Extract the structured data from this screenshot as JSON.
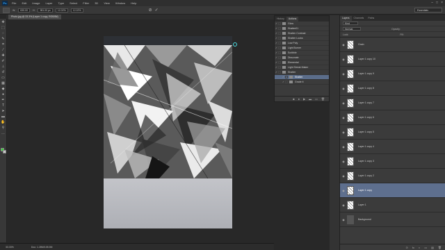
{
  "menubar": {
    "logo": "Ps",
    "items": [
      "File",
      "Edit",
      "Image",
      "Layer",
      "Type",
      "Select",
      "Filter",
      "3D",
      "View",
      "Window",
      "Help"
    ],
    "controls": [
      "–",
      "□",
      "×"
    ]
  },
  "options": {
    "w_label": "W:",
    "w_value": "630.00",
    "h_label": "H:",
    "h_value": "981.00 px",
    "x_value": "12.02%",
    "y_value": "12.02%",
    "essentials": "Essentials"
  },
  "document": {
    "tab_label": "Photo.jpg @ 33.3% (Layer 1 copy, RGB/8#)",
    "zoom": "33.33%",
    "doc_info": "Doc: 1.28M/105.9M"
  },
  "actions_panel": {
    "tabs": [
      "History",
      "Actions"
    ],
    "items": [
      {
        "label": "Glow",
        "selected": false,
        "child": false
      },
      {
        "label": "Shatter01",
        "selected": false,
        "child": false
      },
      {
        "label": "Shatter Contrast",
        "selected": false,
        "child": false
      },
      {
        "label": "Shatter Looks",
        "selected": false,
        "child": false
      },
      {
        "label": "Low Poly",
        "selected": false,
        "child": false
      },
      {
        "label": "Light Burner",
        "selected": false,
        "child": false
      },
      {
        "label": "Scribble",
        "selected": false,
        "child": false
      },
      {
        "label": "Dissonate",
        "selected": false,
        "child": false
      },
      {
        "label": "Elemental",
        "selected": false,
        "child": false
      },
      {
        "label": "Light Streak Maker",
        "selected": false,
        "child": false
      },
      {
        "label": "Shatter",
        "selected": false,
        "child": false
      },
      {
        "label": "Shatter",
        "selected": true,
        "child": true
      },
      {
        "label": "Grade it",
        "selected": false,
        "child": true
      }
    ],
    "footer_icons": [
      "■",
      "●",
      "▶",
      "▬",
      "▭",
      "🗑"
    ]
  },
  "layers_panel": {
    "tabs": [
      "Layers",
      "Channels",
      "Paths"
    ],
    "filter_label": "Kind",
    "blend_mode": "Normal",
    "opacity_label": "Opacity:",
    "lock_label": "Lock:",
    "fill_label": "Fill:",
    "layers": [
      {
        "name": "Grain",
        "selected": false,
        "dark": false
      },
      {
        "name": "Layer 1 copy 10",
        "selected": false,
        "dark": false
      },
      {
        "name": "Layer 1 copy 9",
        "selected": false,
        "dark": false
      },
      {
        "name": "Layer 1 copy 8",
        "selected": false,
        "dark": false
      },
      {
        "name": "Layer 1 copy 7",
        "selected": false,
        "dark": false
      },
      {
        "name": "Layer 1 copy 6",
        "selected": false,
        "dark": false
      },
      {
        "name": "Layer 1 copy 5",
        "selected": false,
        "dark": false
      },
      {
        "name": "Layer 1 copy 4",
        "selected": false,
        "dark": false
      },
      {
        "name": "Layer 1 copy 3",
        "selected": false,
        "dark": false
      },
      {
        "name": "Layer 1 copy 2",
        "selected": false,
        "dark": false
      },
      {
        "name": "Layer 1 copy",
        "selected": true,
        "dark": false
      },
      {
        "name": "Layer 1",
        "selected": false,
        "dark": false
      },
      {
        "name": "Background",
        "selected": false,
        "dark": true
      }
    ],
    "footer_icons": [
      "⊙",
      "fx",
      "◐",
      "▭",
      "▤",
      "🗑"
    ]
  },
  "colors": {
    "foreground": "#3cd33c",
    "background": "#c8c8c8",
    "selection": "#5e6f8e"
  }
}
